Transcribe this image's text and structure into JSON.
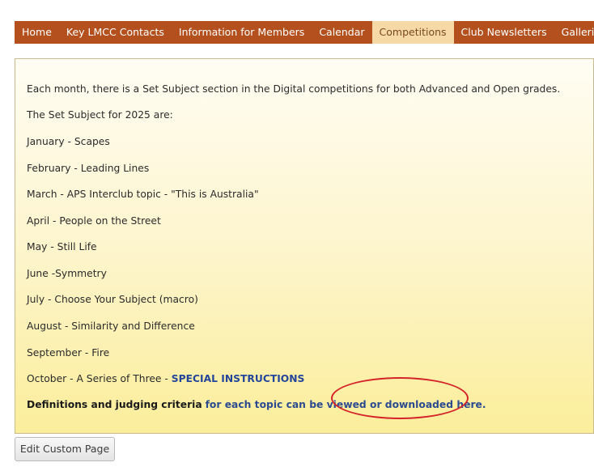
{
  "nav": {
    "items": [
      {
        "label": "Home"
      },
      {
        "label": "Key LMCC Contacts"
      },
      {
        "label": "Information for Members"
      },
      {
        "label": "Calendar"
      },
      {
        "label": "Competitions",
        "active": true
      },
      {
        "label": "Club Newsletters"
      },
      {
        "label": "Galleries"
      }
    ]
  },
  "content": {
    "intro": "Each month, there is a Set Subject section in the Digital competitions for both Advanced and Open grades.",
    "subtitle": "The Set Subject for 2025 are:",
    "months": [
      "January - Scapes",
      "February - Leading Lines",
      "March - APS Interclub topic - \"This is Australia\"",
      "April - People on the Street",
      "May - Still Life",
      "June -Symmetry",
      "July - Choose Your Subject (macro)",
      "August - Similarity and Difference",
      "September - Fire"
    ],
    "october_text": "October - A Series of Three - ",
    "october_link": "SPECIAL INSTRUCTIONS",
    "definitions_bold": "Definitions and judging criteria",
    "definitions_link": "for each topic can be viewed or downloaded here."
  },
  "edit_button": "Edit Custom Page",
  "annotation_color": "#d5232a"
}
